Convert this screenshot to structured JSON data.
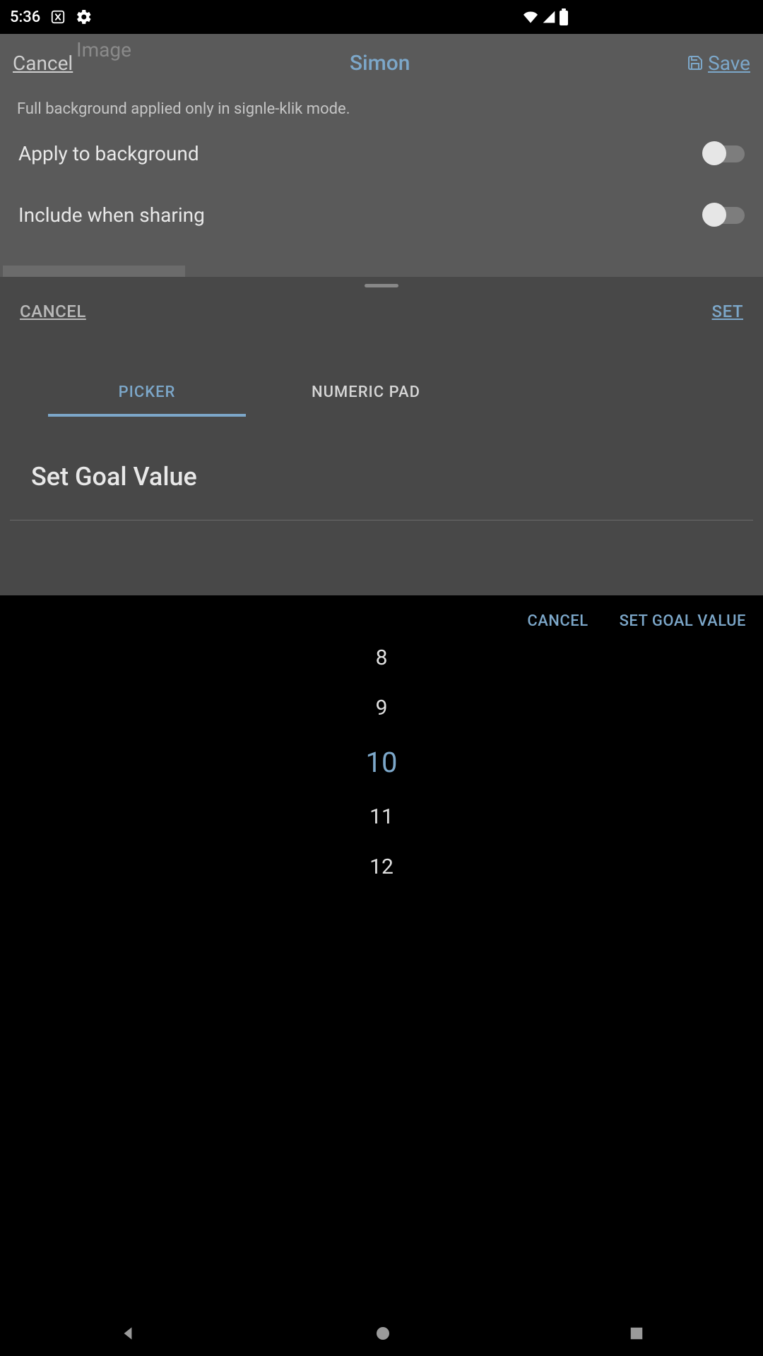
{
  "status": {
    "time": "5:36"
  },
  "bg": {
    "ghost": "Image",
    "cancel": "Cancel",
    "title": "Simon",
    "save": "Save",
    "hint": "Full background applied only in signle-klik mode.",
    "row1": "Apply to background",
    "row2": "Include when sharing"
  },
  "mid": {
    "cancel": "CANCEL",
    "set": "SET",
    "tab_picker": "PICKER",
    "tab_numeric": "NUMERIC PAD",
    "goal_title": "Set Goal Value"
  },
  "picker": {
    "cancel": "CANCEL",
    "confirm": "SET GOAL VALUE",
    "values": [
      "8",
      "9",
      "10",
      "11",
      "12"
    ],
    "selected": "10"
  }
}
